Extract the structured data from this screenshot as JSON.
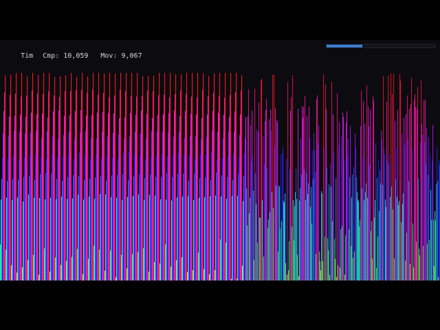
{
  "hud": {
    "algorithm": "Tim",
    "comparisons_label": "Cmp: 10,059",
    "moves_label": "Mov: 9,067"
  },
  "progress": {
    "fraction": 0.33,
    "fill_color": "#3b7fd1"
  },
  "visualization": {
    "background_color": "#0b0b10",
    "bar_count": 640,
    "sorted_run_length": 8,
    "sorted_region_fraction": 0.56,
    "min_value_fraction": 0.3,
    "color_scale": "rainbow-hue-by-value"
  }
}
